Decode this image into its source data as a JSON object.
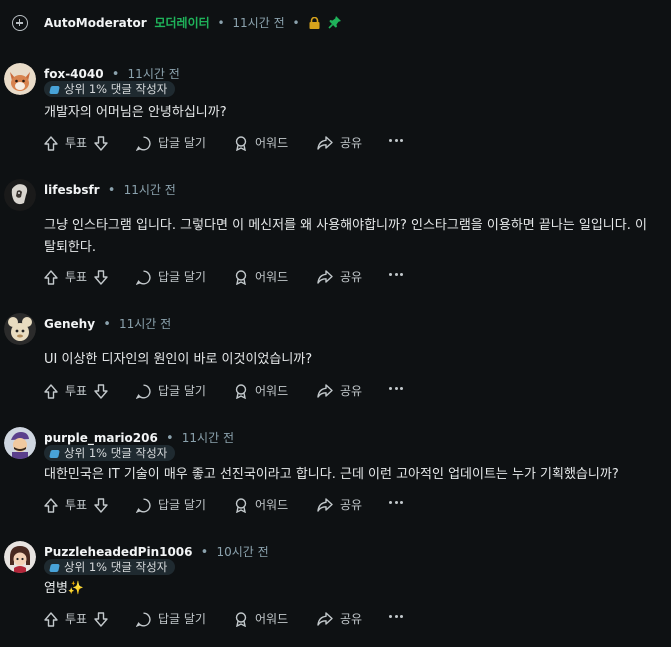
{
  "top_comment": {
    "author": "AutoModerator",
    "mod_tag": "모더레이터",
    "separator": "•",
    "time": "11시간 전",
    "separator2": "•"
  },
  "actions": {
    "vote_label": "투표",
    "reply_label": "답글 달기",
    "award_label": "어워드",
    "share_label": "공유"
  },
  "comments": [
    {
      "author": "fox-4040",
      "time": "11시간 전",
      "flair": "상위 1% 댓글 작성자",
      "text_lines": [
        "개발자의 어머님은 안녕하십니까?"
      ]
    },
    {
      "author": "lifesbsfr",
      "time": "11시간 전",
      "flair": "",
      "text_lines": [
        "그냥 인스타그램 입니다. 그렇다면 이 메신저를 왜 사용해야합니까? 인스타그램을 이용하면 끝나는 일입니다. 이",
        "탈퇴한다."
      ]
    },
    {
      "author": "Genehy",
      "time": "11시간 전",
      "flair": "",
      "text_lines": [
        "UI 이상한 디자인의 원인이 바로 이것이었습니까?"
      ]
    },
    {
      "author": "purple_mario206",
      "time": "11시간 전",
      "flair": "상위 1% 댓글 작성자",
      "text_lines": [
        "대한민국은 IT 기술이 매우 좋고 선진국이라고 합니다. 근데 이런 고아적인 업데이트는 누가 기획했습니까?"
      ]
    },
    {
      "author": "PuzzleheadedPin1006",
      "time": "10시간 전",
      "flair": "상위 1% 댓글 작성자",
      "text_lines": [
        "염병✨"
      ]
    }
  ],
  "colors": {
    "background": "#0e1113",
    "mod_green": "#1fb35a",
    "meta_gray": "#8ba2ad",
    "flair_bg": "#1f2a30"
  }
}
